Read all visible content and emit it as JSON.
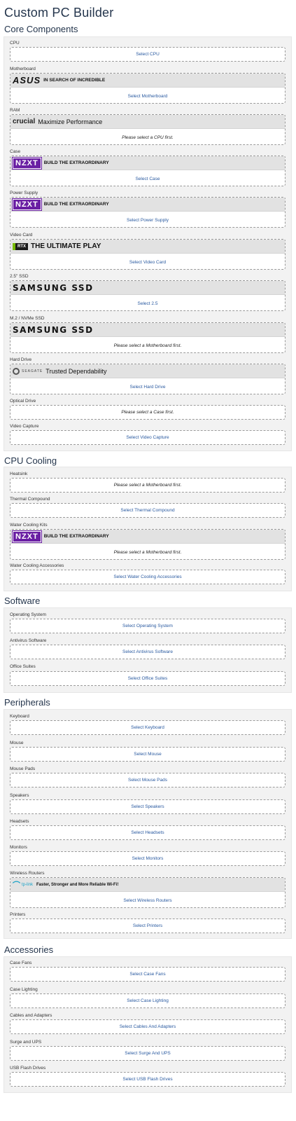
{
  "page_title": "Custom PC Builder",
  "sections": {
    "core": {
      "title": "Core Components",
      "cpu": {
        "label": "CPU",
        "action": "Select CPU"
      },
      "motherboard": {
        "label": "Motherboard",
        "ad_logo": "ASUS",
        "ad_text": "IN SEARCH OF INCREDIBLE",
        "action": "Select Motherboard"
      },
      "ram": {
        "label": "RAM",
        "ad_logo": "crucial",
        "ad_text": "Maximize Performance",
        "action": "Please select a CPU first."
      },
      "case": {
        "label": "Case",
        "ad_logo": "NZXT",
        "ad_text": "BUILD THE EXTRAORDINARY",
        "action": "Select Case"
      },
      "power_supply": {
        "label": "Power Supply",
        "ad_logo": "NZXT",
        "ad_text": "BUILD THE EXTRAORDINARY",
        "action": "Select Power Supply"
      },
      "video_card": {
        "label": "Video Card",
        "ad_logo": "RTX",
        "ad_text": "THE ULTIMATE PLAY",
        "action": "Select Video Card"
      },
      "ssd_25": {
        "label": "2.5\" SSD",
        "ad_logo": "SAMSUNG SSD",
        "action": "Select 2.5"
      },
      "ssd_m2": {
        "label": "M.2 / NVMe SSD",
        "ad_logo": "SAMSUNG SSD",
        "action": "Please select a Motherboard first."
      },
      "hard_drive": {
        "label": "Hard Drive",
        "ad_logo": "SEAGATE",
        "ad_text": "Trusted Dependability",
        "action": "Select Hard Drive"
      },
      "optical_drive": {
        "label": "Optical Drive",
        "action": "Please select a Case first."
      },
      "video_capture": {
        "label": "Video Capture",
        "action": "Select Video Capture"
      }
    },
    "cooling": {
      "title": "CPU Cooling",
      "heatsink": {
        "label": "Heatsink",
        "action": "Please select a Motherboard first."
      },
      "thermal": {
        "label": "Thermal Compound",
        "action": "Select Thermal Compound"
      },
      "water_kits": {
        "label": "Water Cooling Kits",
        "ad_logo": "NZXT",
        "ad_text": "BUILD THE EXTRAORDINARY",
        "action": "Please select a Motherboard first."
      },
      "water_acc": {
        "label": "Water Cooling Accessories",
        "action": "Select Water Cooling Accessories"
      }
    },
    "software": {
      "title": "Software",
      "os": {
        "label": "Operating System",
        "action": "Select Operating System"
      },
      "antivirus": {
        "label": "Antivirus Software",
        "action": "Select Antivirus Software"
      },
      "office": {
        "label": "Office Suites",
        "action": "Select Office Suites"
      }
    },
    "peripherals": {
      "title": "Peripherals",
      "keyboard": {
        "label": "Keyboard",
        "action": "Select Keyboard"
      },
      "mouse": {
        "label": "Mouse",
        "action": "Select Mouse"
      },
      "mouse_pads": {
        "label": "Mouse Pads",
        "action": "Select Mouse Pads"
      },
      "speakers": {
        "label": "Speakers",
        "action": "Select Speakers"
      },
      "headsets": {
        "label": "Headsets",
        "action": "Select Headsets"
      },
      "monitors": {
        "label": "Monitors",
        "action": "Select Monitors"
      },
      "routers": {
        "label": "Wireless Routers",
        "ad_logo": "tp-link",
        "ad_text": "Faster, Stronger and More Reliable Wi-Fi!",
        "action": "Select Wireless Routers"
      },
      "printers": {
        "label": "Printers",
        "action": "Select Printers"
      }
    },
    "accessories": {
      "title": "Accessories",
      "case_fans": {
        "label": "Case Fans",
        "action": "Select Case Fans"
      },
      "case_lighting": {
        "label": "Case Lighting",
        "action": "Select Case Lighting"
      },
      "cables": {
        "label": "Cables and Adapters",
        "action": "Select Cables And Adapters"
      },
      "surge": {
        "label": "Surge and UPS",
        "action": "Select Surge And UPS"
      },
      "usb": {
        "label": "USB Flash Drives",
        "action": "Select USB Flash Drives"
      }
    }
  },
  "colors": {
    "link": "#2a5aa0",
    "panel_bg": "#f2f2f2",
    "nzxt_purple": "#6a1fa3",
    "nvidia_green": "#76b900"
  }
}
